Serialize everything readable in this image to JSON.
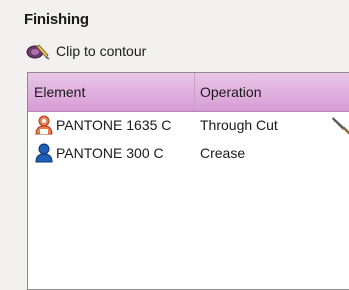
{
  "section": {
    "title": "Finishing"
  },
  "clip": {
    "label": "Clip to contour",
    "icon": "clip-contour-icon"
  },
  "table": {
    "columns": [
      "Element",
      "Operation"
    ],
    "rows": [
      {
        "element": "PANTONE 1635 C",
        "operation": "Through Cut",
        "icon": "person-icon",
        "color": "#f07a4c",
        "edit_icon": "knife-icon"
      },
      {
        "element": "PANTONE 300 C",
        "operation": "Crease",
        "icon": "person-icon",
        "color": "#1f5fb8"
      }
    ]
  },
  "colors": {
    "header_top": "#e9c6e6",
    "header_bottom": "#d79cd6"
  }
}
